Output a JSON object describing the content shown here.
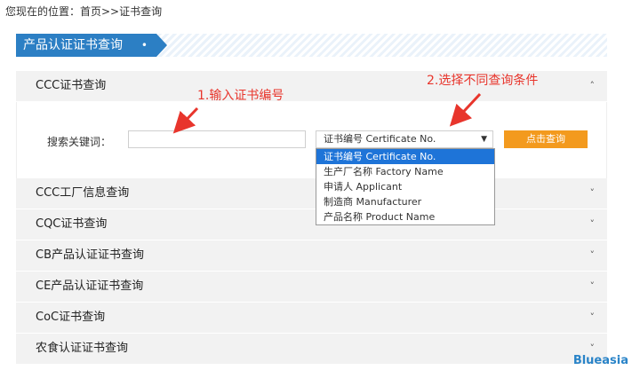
{
  "breadcrumb": {
    "text": "您现在的位置：首页>>证书查询"
  },
  "title": {
    "label": "产品认证证书查询",
    "dot": "•"
  },
  "sections": {
    "ccc": "CCC证书查询",
    "factory": "CCC工厂信息查询",
    "cqc": "CQC证书查询",
    "cb": "CB产品认证证书查询",
    "ce": "CE产品认证证书查询",
    "coc": "CoC证书查询",
    "food": "农食认证证书查询"
  },
  "search": {
    "keyword_label": "搜索关键词：",
    "keyword_value": "",
    "selected": "证书编号 Certificate No.",
    "button": "点击查询",
    "options": [
      "证书编号 Certificate No.",
      "生产厂名称 Factory Name",
      "申请人 Applicant",
      "制造商 Manufacturer",
      "产品名称 Product Name"
    ]
  },
  "annotations": {
    "step1": "1.输入证书编号",
    "step2": "2.选择不同查询条件"
  },
  "watermark": "Blueasia",
  "icons": {
    "expanded": "chevron-up-icon",
    "collapsed": "chevron-down-icon",
    "select": "caret-down-icon"
  },
  "colors": {
    "accent": "#2c7fc4",
    "button": "#f39a1e",
    "annotation": "#e8352c",
    "selected_option": "#1e74d8"
  }
}
